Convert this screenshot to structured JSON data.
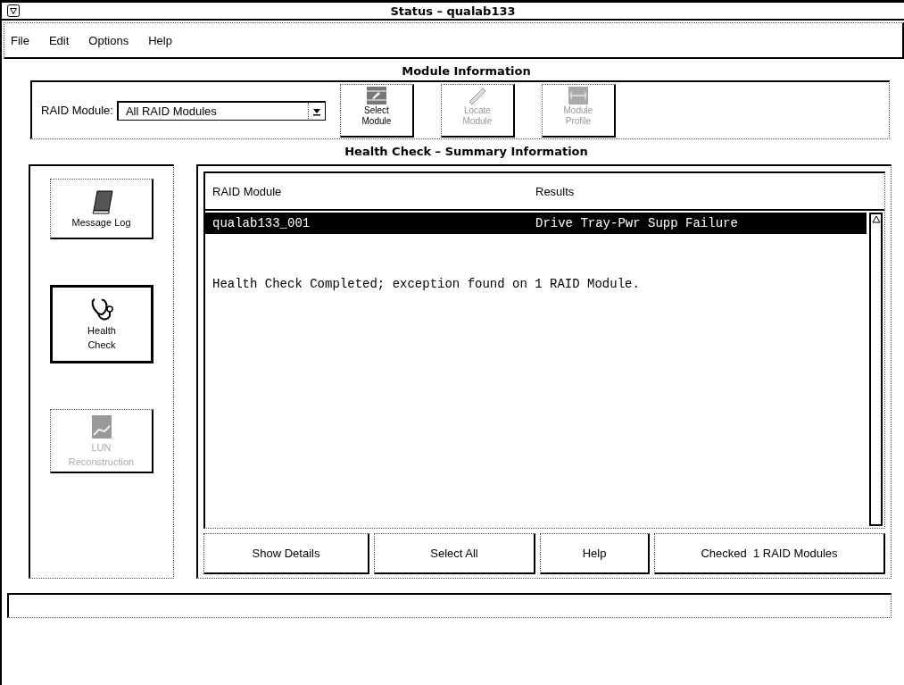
{
  "window": {
    "title": "Status – qualab133"
  },
  "menu": [
    "File",
    "Edit",
    "Options",
    "Help"
  ],
  "module_information": {
    "heading": "Module Information",
    "raid_module_label": "RAID Module:",
    "raid_module_value": "All RAID Modules",
    "tools": [
      {
        "kind": "select",
        "label": "Select\nModule",
        "disabled": false
      },
      {
        "kind": "locate",
        "label": "Locate\nModule",
        "disabled": true
      },
      {
        "kind": "profile",
        "label": "Module\nProfile",
        "disabled": true
      }
    ]
  },
  "health_check": {
    "heading": "Health Check – Summary Information",
    "sidebar": [
      {
        "kind": "log",
        "label": "Message Log",
        "selected": false,
        "disabled": false
      },
      {
        "kind": "health",
        "label": "Health\nCheck",
        "selected": true,
        "disabled": false
      },
      {
        "kind": "lun",
        "label": "LUN\nReconstruction",
        "selected": false,
        "disabled": true
      }
    ],
    "columns": [
      "RAID Module",
      "Results"
    ],
    "rows": [
      {
        "cells": [
          "qualab133_001",
          "Drive Tray-Pwr Supp Failure"
        ],
        "selected": true
      }
    ],
    "message": "Health Check Completed; exception found on 1 RAID Module.",
    "buttons": [
      "Show Details",
      "Select All",
      "Help"
    ],
    "summary": "Checked  1 RAID Modules"
  }
}
